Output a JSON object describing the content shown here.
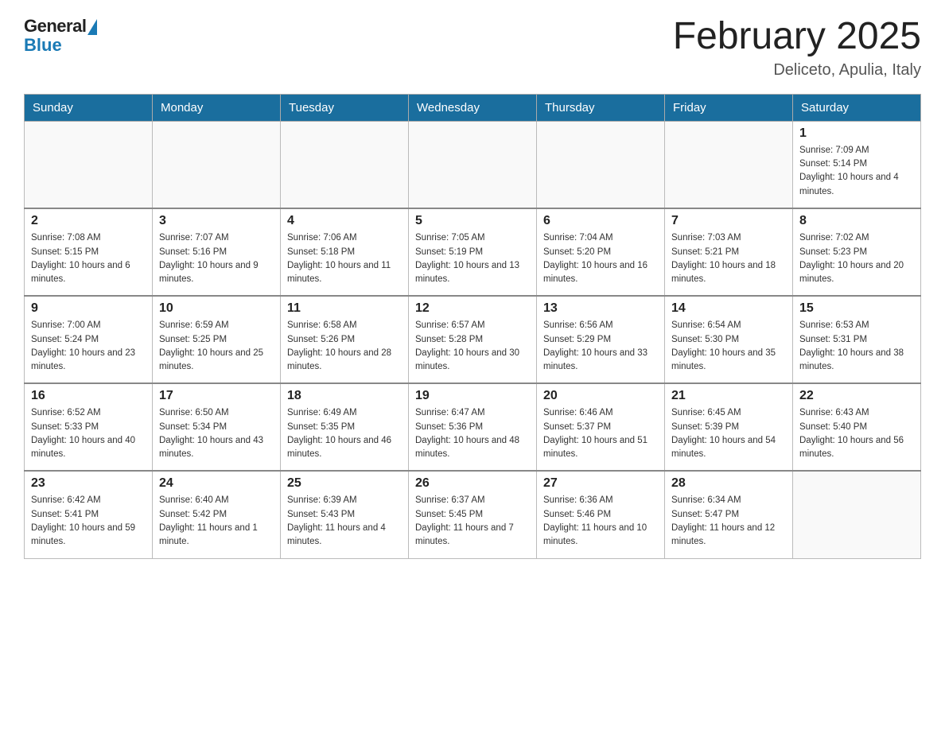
{
  "header": {
    "logo_general": "General",
    "logo_blue": "Blue",
    "title": "February 2025",
    "subtitle": "Deliceto, Apulia, Italy"
  },
  "weekdays": [
    "Sunday",
    "Monday",
    "Tuesday",
    "Wednesday",
    "Thursday",
    "Friday",
    "Saturday"
  ],
  "weeks": [
    [
      {
        "day": "",
        "info": ""
      },
      {
        "day": "",
        "info": ""
      },
      {
        "day": "",
        "info": ""
      },
      {
        "day": "",
        "info": ""
      },
      {
        "day": "",
        "info": ""
      },
      {
        "day": "",
        "info": ""
      },
      {
        "day": "1",
        "info": "Sunrise: 7:09 AM\nSunset: 5:14 PM\nDaylight: 10 hours and 4 minutes."
      }
    ],
    [
      {
        "day": "2",
        "info": "Sunrise: 7:08 AM\nSunset: 5:15 PM\nDaylight: 10 hours and 6 minutes."
      },
      {
        "day": "3",
        "info": "Sunrise: 7:07 AM\nSunset: 5:16 PM\nDaylight: 10 hours and 9 minutes."
      },
      {
        "day": "4",
        "info": "Sunrise: 7:06 AM\nSunset: 5:18 PM\nDaylight: 10 hours and 11 minutes."
      },
      {
        "day": "5",
        "info": "Sunrise: 7:05 AM\nSunset: 5:19 PM\nDaylight: 10 hours and 13 minutes."
      },
      {
        "day": "6",
        "info": "Sunrise: 7:04 AM\nSunset: 5:20 PM\nDaylight: 10 hours and 16 minutes."
      },
      {
        "day": "7",
        "info": "Sunrise: 7:03 AM\nSunset: 5:21 PM\nDaylight: 10 hours and 18 minutes."
      },
      {
        "day": "8",
        "info": "Sunrise: 7:02 AM\nSunset: 5:23 PM\nDaylight: 10 hours and 20 minutes."
      }
    ],
    [
      {
        "day": "9",
        "info": "Sunrise: 7:00 AM\nSunset: 5:24 PM\nDaylight: 10 hours and 23 minutes."
      },
      {
        "day": "10",
        "info": "Sunrise: 6:59 AM\nSunset: 5:25 PM\nDaylight: 10 hours and 25 minutes."
      },
      {
        "day": "11",
        "info": "Sunrise: 6:58 AM\nSunset: 5:26 PM\nDaylight: 10 hours and 28 minutes."
      },
      {
        "day": "12",
        "info": "Sunrise: 6:57 AM\nSunset: 5:28 PM\nDaylight: 10 hours and 30 minutes."
      },
      {
        "day": "13",
        "info": "Sunrise: 6:56 AM\nSunset: 5:29 PM\nDaylight: 10 hours and 33 minutes."
      },
      {
        "day": "14",
        "info": "Sunrise: 6:54 AM\nSunset: 5:30 PM\nDaylight: 10 hours and 35 minutes."
      },
      {
        "day": "15",
        "info": "Sunrise: 6:53 AM\nSunset: 5:31 PM\nDaylight: 10 hours and 38 minutes."
      }
    ],
    [
      {
        "day": "16",
        "info": "Sunrise: 6:52 AM\nSunset: 5:33 PM\nDaylight: 10 hours and 40 minutes."
      },
      {
        "day": "17",
        "info": "Sunrise: 6:50 AM\nSunset: 5:34 PM\nDaylight: 10 hours and 43 minutes."
      },
      {
        "day": "18",
        "info": "Sunrise: 6:49 AM\nSunset: 5:35 PM\nDaylight: 10 hours and 46 minutes."
      },
      {
        "day": "19",
        "info": "Sunrise: 6:47 AM\nSunset: 5:36 PM\nDaylight: 10 hours and 48 minutes."
      },
      {
        "day": "20",
        "info": "Sunrise: 6:46 AM\nSunset: 5:37 PM\nDaylight: 10 hours and 51 minutes."
      },
      {
        "day": "21",
        "info": "Sunrise: 6:45 AM\nSunset: 5:39 PM\nDaylight: 10 hours and 54 minutes."
      },
      {
        "day": "22",
        "info": "Sunrise: 6:43 AM\nSunset: 5:40 PM\nDaylight: 10 hours and 56 minutes."
      }
    ],
    [
      {
        "day": "23",
        "info": "Sunrise: 6:42 AM\nSunset: 5:41 PM\nDaylight: 10 hours and 59 minutes."
      },
      {
        "day": "24",
        "info": "Sunrise: 6:40 AM\nSunset: 5:42 PM\nDaylight: 11 hours and 1 minute."
      },
      {
        "day": "25",
        "info": "Sunrise: 6:39 AM\nSunset: 5:43 PM\nDaylight: 11 hours and 4 minutes."
      },
      {
        "day": "26",
        "info": "Sunrise: 6:37 AM\nSunset: 5:45 PM\nDaylight: 11 hours and 7 minutes."
      },
      {
        "day": "27",
        "info": "Sunrise: 6:36 AM\nSunset: 5:46 PM\nDaylight: 11 hours and 10 minutes."
      },
      {
        "day": "28",
        "info": "Sunrise: 6:34 AM\nSunset: 5:47 PM\nDaylight: 11 hours and 12 minutes."
      },
      {
        "day": "",
        "info": ""
      }
    ]
  ]
}
